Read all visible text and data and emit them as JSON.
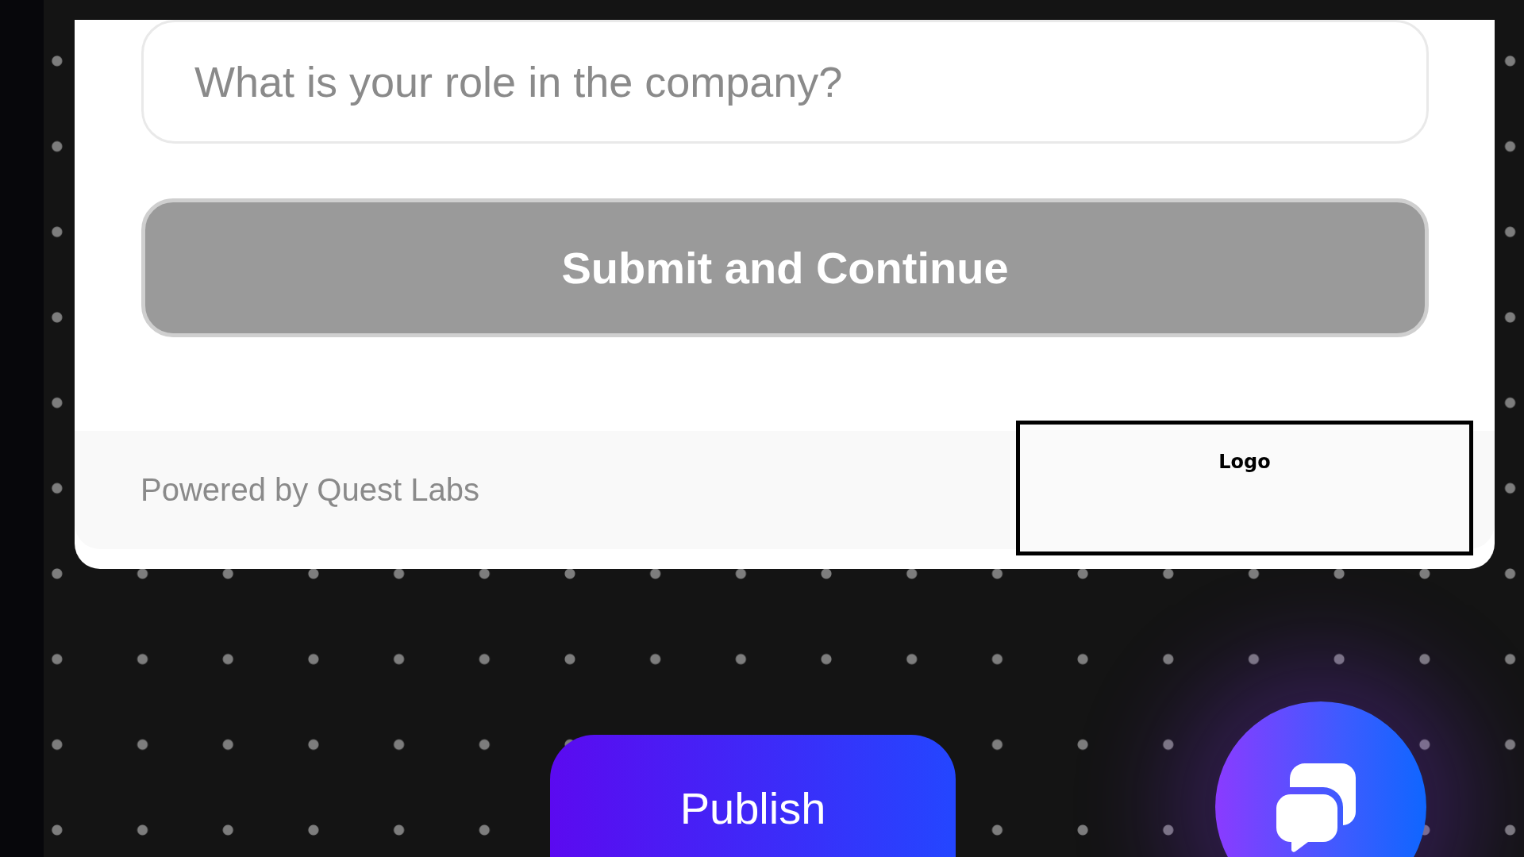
{
  "form": {
    "input": {
      "placeholder": "What is your role in the company?"
    },
    "submit_button": {
      "label": "Submit and Continue",
      "disabled": true
    },
    "footer": {
      "text": "Powered by Quest Labs"
    },
    "logo": {
      "label": "Logo"
    }
  },
  "publish_button": {
    "label": "Publish"
  },
  "chat_button": {
    "kind": "chat"
  }
}
